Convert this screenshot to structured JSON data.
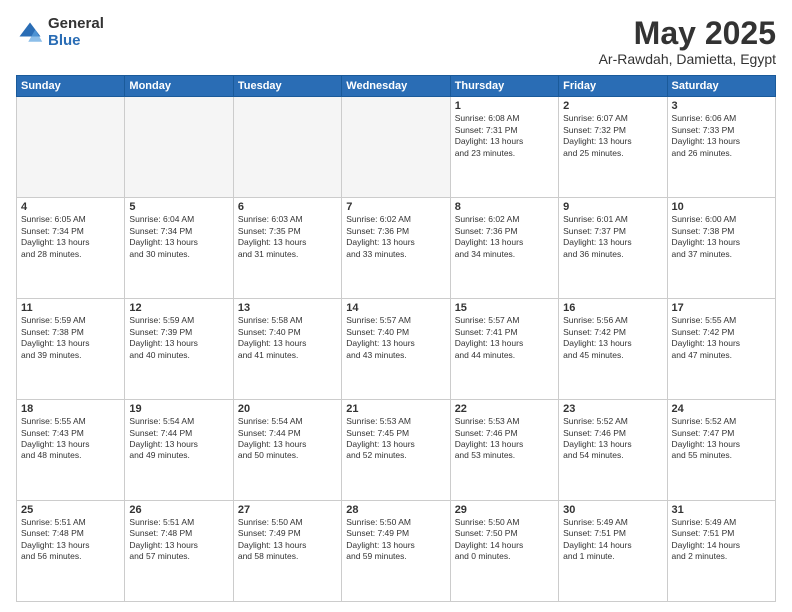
{
  "logo": {
    "general": "General",
    "blue": "Blue"
  },
  "title": "May 2025",
  "location": "Ar-Rawdah, Damietta, Egypt",
  "weekdays": [
    "Sunday",
    "Monday",
    "Tuesday",
    "Wednesday",
    "Thursday",
    "Friday",
    "Saturday"
  ],
  "weeks": [
    [
      {
        "day": "",
        "info": ""
      },
      {
        "day": "",
        "info": ""
      },
      {
        "day": "",
        "info": ""
      },
      {
        "day": "",
        "info": ""
      },
      {
        "day": "1",
        "info": "Sunrise: 6:08 AM\nSunset: 7:31 PM\nDaylight: 13 hours\nand 23 minutes."
      },
      {
        "day": "2",
        "info": "Sunrise: 6:07 AM\nSunset: 7:32 PM\nDaylight: 13 hours\nand 25 minutes."
      },
      {
        "day": "3",
        "info": "Sunrise: 6:06 AM\nSunset: 7:33 PM\nDaylight: 13 hours\nand 26 minutes."
      }
    ],
    [
      {
        "day": "4",
        "info": "Sunrise: 6:05 AM\nSunset: 7:34 PM\nDaylight: 13 hours\nand 28 minutes."
      },
      {
        "day": "5",
        "info": "Sunrise: 6:04 AM\nSunset: 7:34 PM\nDaylight: 13 hours\nand 30 minutes."
      },
      {
        "day": "6",
        "info": "Sunrise: 6:03 AM\nSunset: 7:35 PM\nDaylight: 13 hours\nand 31 minutes."
      },
      {
        "day": "7",
        "info": "Sunrise: 6:02 AM\nSunset: 7:36 PM\nDaylight: 13 hours\nand 33 minutes."
      },
      {
        "day": "8",
        "info": "Sunrise: 6:02 AM\nSunset: 7:36 PM\nDaylight: 13 hours\nand 34 minutes."
      },
      {
        "day": "9",
        "info": "Sunrise: 6:01 AM\nSunset: 7:37 PM\nDaylight: 13 hours\nand 36 minutes."
      },
      {
        "day": "10",
        "info": "Sunrise: 6:00 AM\nSunset: 7:38 PM\nDaylight: 13 hours\nand 37 minutes."
      }
    ],
    [
      {
        "day": "11",
        "info": "Sunrise: 5:59 AM\nSunset: 7:38 PM\nDaylight: 13 hours\nand 39 minutes."
      },
      {
        "day": "12",
        "info": "Sunrise: 5:59 AM\nSunset: 7:39 PM\nDaylight: 13 hours\nand 40 minutes."
      },
      {
        "day": "13",
        "info": "Sunrise: 5:58 AM\nSunset: 7:40 PM\nDaylight: 13 hours\nand 41 minutes."
      },
      {
        "day": "14",
        "info": "Sunrise: 5:57 AM\nSunset: 7:40 PM\nDaylight: 13 hours\nand 43 minutes."
      },
      {
        "day": "15",
        "info": "Sunrise: 5:57 AM\nSunset: 7:41 PM\nDaylight: 13 hours\nand 44 minutes."
      },
      {
        "day": "16",
        "info": "Sunrise: 5:56 AM\nSunset: 7:42 PM\nDaylight: 13 hours\nand 45 minutes."
      },
      {
        "day": "17",
        "info": "Sunrise: 5:55 AM\nSunset: 7:42 PM\nDaylight: 13 hours\nand 47 minutes."
      }
    ],
    [
      {
        "day": "18",
        "info": "Sunrise: 5:55 AM\nSunset: 7:43 PM\nDaylight: 13 hours\nand 48 minutes."
      },
      {
        "day": "19",
        "info": "Sunrise: 5:54 AM\nSunset: 7:44 PM\nDaylight: 13 hours\nand 49 minutes."
      },
      {
        "day": "20",
        "info": "Sunrise: 5:54 AM\nSunset: 7:44 PM\nDaylight: 13 hours\nand 50 minutes."
      },
      {
        "day": "21",
        "info": "Sunrise: 5:53 AM\nSunset: 7:45 PM\nDaylight: 13 hours\nand 52 minutes."
      },
      {
        "day": "22",
        "info": "Sunrise: 5:53 AM\nSunset: 7:46 PM\nDaylight: 13 hours\nand 53 minutes."
      },
      {
        "day": "23",
        "info": "Sunrise: 5:52 AM\nSunset: 7:46 PM\nDaylight: 13 hours\nand 54 minutes."
      },
      {
        "day": "24",
        "info": "Sunrise: 5:52 AM\nSunset: 7:47 PM\nDaylight: 13 hours\nand 55 minutes."
      }
    ],
    [
      {
        "day": "25",
        "info": "Sunrise: 5:51 AM\nSunset: 7:48 PM\nDaylight: 13 hours\nand 56 minutes."
      },
      {
        "day": "26",
        "info": "Sunrise: 5:51 AM\nSunset: 7:48 PM\nDaylight: 13 hours\nand 57 minutes."
      },
      {
        "day": "27",
        "info": "Sunrise: 5:50 AM\nSunset: 7:49 PM\nDaylight: 13 hours\nand 58 minutes."
      },
      {
        "day": "28",
        "info": "Sunrise: 5:50 AM\nSunset: 7:49 PM\nDaylight: 13 hours\nand 59 minutes."
      },
      {
        "day": "29",
        "info": "Sunrise: 5:50 AM\nSunset: 7:50 PM\nDaylight: 14 hours\nand 0 minutes."
      },
      {
        "day": "30",
        "info": "Sunrise: 5:49 AM\nSunset: 7:51 PM\nDaylight: 14 hours\nand 1 minute."
      },
      {
        "day": "31",
        "info": "Sunrise: 5:49 AM\nSunset: 7:51 PM\nDaylight: 14 hours\nand 2 minutes."
      }
    ]
  ]
}
